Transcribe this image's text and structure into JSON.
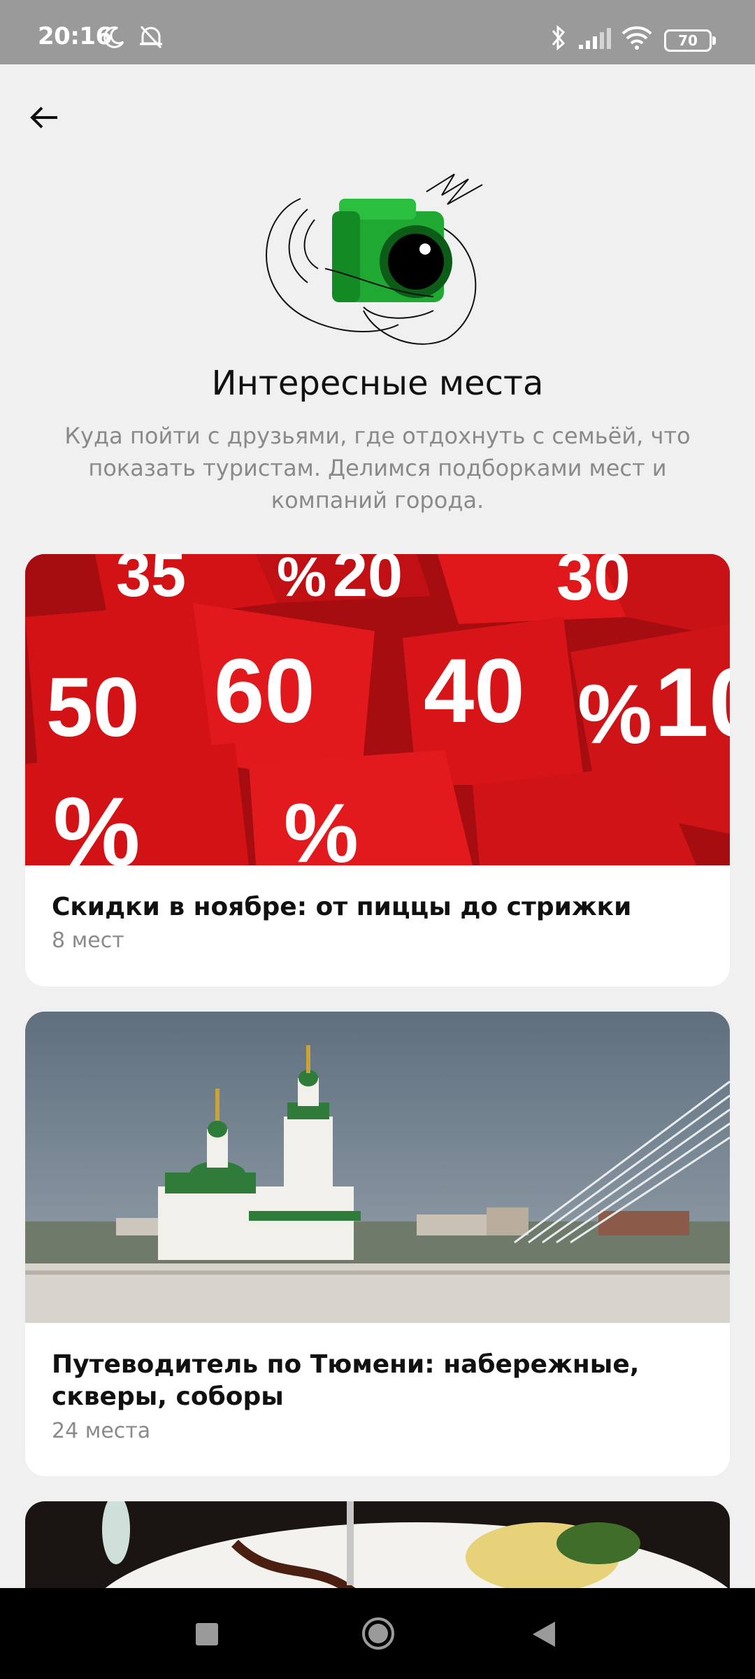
{
  "status_bar": {
    "time": "20:16",
    "battery": "70"
  },
  "header": {
    "title": "Интересные места",
    "description": "Куда пойти с друзьями, где отдохнуть с семьёй, что показать туристам. Делимся подборками мест и компаний города."
  },
  "cards": [
    {
      "title": "Скидки в ноябре: от пиццы до стрижки",
      "count": "8 мест",
      "image_labels": [
        "35",
        "%",
        "20",
        "30",
        "50",
        "60",
        "40",
        "10",
        "%",
        "%",
        "%"
      ]
    },
    {
      "title": "Путеводитель по Тюмени: набережные, скверы, соборы",
      "count": "24 места"
    },
    {
      "title": "",
      "count": ""
    }
  ],
  "colors": {
    "accent_green": "#1fa832",
    "discount_red": "#d31216",
    "background": "#f0f0f0",
    "secondary_text": "#8a8a8a"
  },
  "icons": {
    "back": "arrow-left-icon",
    "nav": [
      "square-icon",
      "circle-home-icon",
      "triangle-back-icon"
    ]
  }
}
